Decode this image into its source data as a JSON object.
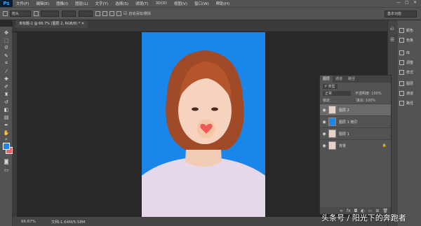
{
  "app": {
    "logo": "Ps"
  },
  "menu": [
    "文件(F)",
    "编辑(E)",
    "图像(I)",
    "图层(L)",
    "文字(Y)",
    "选择(S)",
    "滤镜(T)",
    "3D(D)",
    "视图(V)",
    "窗口(W)",
    "帮助(H)"
  ],
  "options": {
    "tool_preset": "箭头",
    "auto_blend": "自动添加/删除",
    "workspace": "基本功能"
  },
  "document": {
    "tab": "未标题-1 @ 66.7% (图层 2, RGB/8) *",
    "zoom": "66.67%",
    "doc_info": "文档:1.64M/5.58M"
  },
  "dock": [
    "颜色",
    "色板",
    "库",
    "调整",
    "样式",
    "图层",
    "通道",
    "路径"
  ],
  "layers_panel": {
    "tabs": [
      "图层",
      "通道",
      "路径"
    ],
    "filter": "P 类型",
    "blend": "正常",
    "opacity": "不透明度: 100%",
    "lock": "锁定:",
    "fill": "填充: 100%",
    "layers": [
      {
        "name": "图层 2",
        "active": true
      },
      {
        "name": "图层 1 拷贝",
        "active": false
      },
      {
        "name": "图层 1",
        "active": false
      },
      {
        "name": "背景",
        "active": false
      }
    ]
  },
  "colors": {
    "foreground": "#1b86ea",
    "background": "#ef6565",
    "canvas_bg": "#1b86ea"
  },
  "watermark": "头条号 / 阳光下的奔跑者"
}
